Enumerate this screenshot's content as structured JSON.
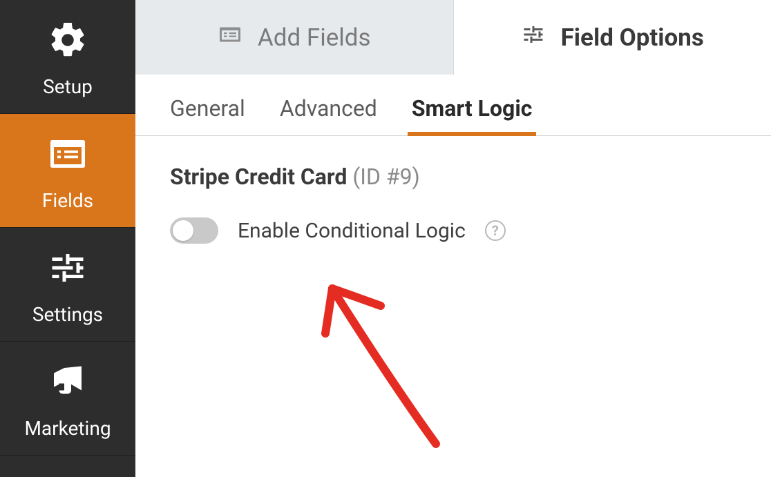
{
  "sidebar": {
    "items": [
      {
        "label": "Setup"
      },
      {
        "label": "Fields"
      },
      {
        "label": "Settings"
      },
      {
        "label": "Marketing"
      }
    ]
  },
  "topTabs": {
    "addFields": "Add Fields",
    "fieldOptions": "Field Options"
  },
  "subTabs": {
    "general": "General",
    "advanced": "Advanced",
    "smartLogic": "Smart Logic"
  },
  "field": {
    "name": "Stripe Credit Card",
    "idLabel": "(ID #9)"
  },
  "optionRow": {
    "label": "Enable Conditional Logic"
  }
}
